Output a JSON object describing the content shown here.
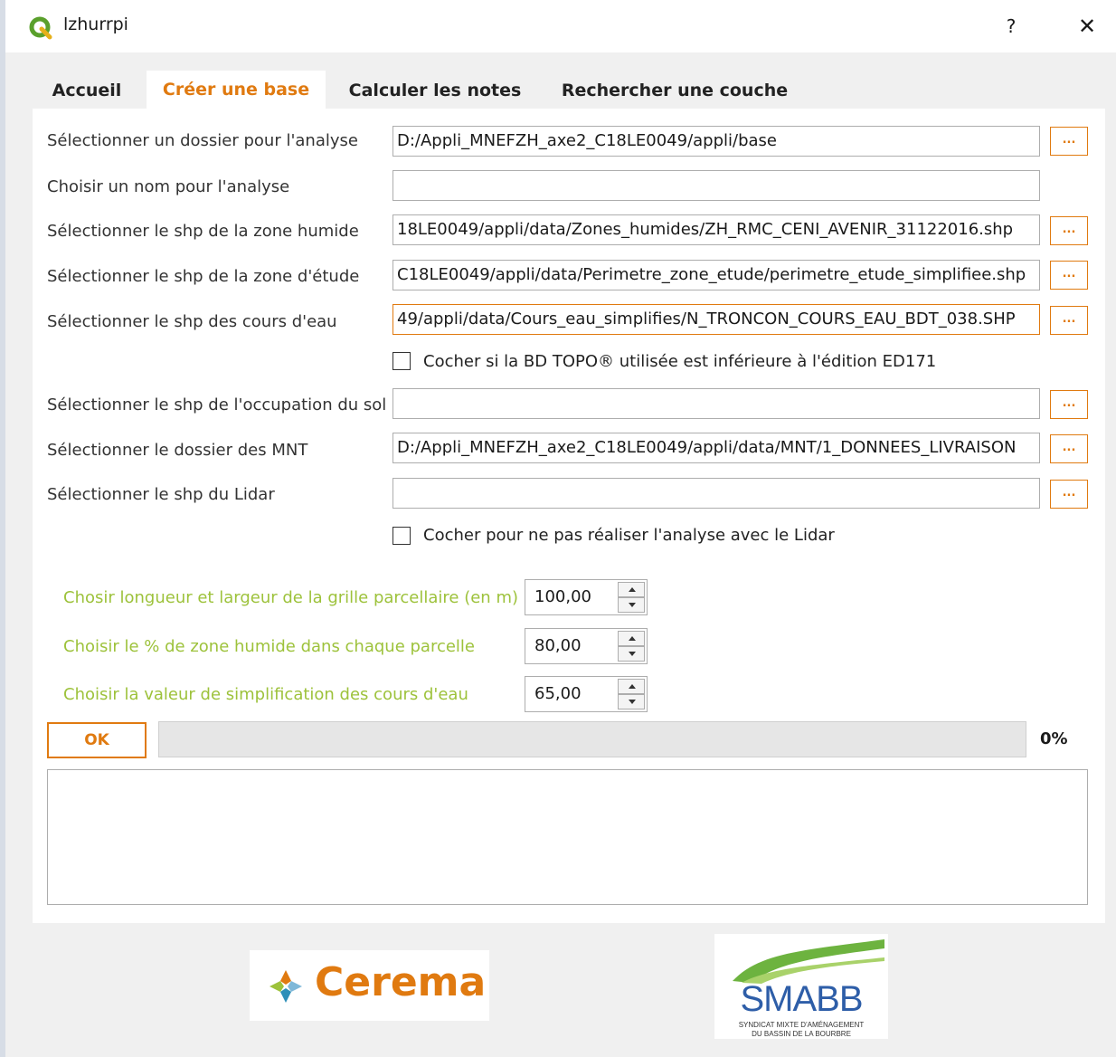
{
  "window": {
    "title": "lzhurrpi",
    "help_label": "?",
    "close_label": "✕"
  },
  "tabs": [
    {
      "label": "Accueil"
    },
    {
      "label": "Créer une base"
    },
    {
      "label": "Calculer les notes"
    },
    {
      "label": "Rechercher une couche"
    }
  ],
  "active_tab": "Créer une base",
  "form": {
    "folder": {
      "label": "Sélectionner un dossier pour l'analyse",
      "value": "D:/Appli_MNEFZH_axe2_C18LE0049/appli/base"
    },
    "name": {
      "label": "Choisir un nom pour l'analyse",
      "value": ""
    },
    "zone_humide": {
      "label": "Sélectionner le shp de la zone humide",
      "value": "18LE0049/appli/data/Zones_humides/ZH_RMC_CENI_AVENIR_31122016.shp"
    },
    "zone_etude": {
      "label": "Sélectionner le shp de la zone d'étude",
      "value": "C18LE0049/appli/data/Perimetre_zone_etude/perimetre_etude_simplifiee.shp"
    },
    "cours_eau": {
      "label": "Sélectionner le shp des cours d'eau",
      "value": "49/appli/data/Cours_eau_simplifies/N_TRONCON_COURS_EAU_BDT_038.SHP"
    },
    "bdtopo_check": {
      "label": "Cocher si la BD TOPO® utilisée est inférieure à l'édition ED171",
      "checked": false
    },
    "occupation_sol": {
      "label": "Sélectionner le shp de l'occupation du sol",
      "value": ""
    },
    "mnt": {
      "label": "Sélectionner le dossier des MNT",
      "value": "D:/Appli_MNEFZH_axe2_C18LE0049/appli/data/MNT/1_DONNEES_LIVRAISON"
    },
    "lidar": {
      "label": "Sélectionner le shp du Lidar",
      "value": ""
    },
    "lidar_check": {
      "label": "Cocher pour ne pas réaliser l'analyse avec le Lidar",
      "checked": false
    },
    "browse_label": "..."
  },
  "params": {
    "grille": {
      "label": "Chosir longueur et largeur de la grille parcellaire (en m)",
      "value": "100,00"
    },
    "pct_zh": {
      "label": "Choisir le % de zone humide dans chaque parcelle",
      "value": "80,00"
    },
    "simplification": {
      "label": "Choisir la valeur de simplification des cours d'eau",
      "value": "65,00"
    }
  },
  "actions": {
    "ok_label": "OK",
    "progress": 0,
    "progress_text": "0%"
  },
  "log": {
    "text": ""
  },
  "logos": {
    "cerema": {
      "text": "Cerema"
    },
    "smabb": {
      "text": "SMABB",
      "sub1": "SYNDICAT MIXTE D'AMÉNAGEMENT",
      "sub2": "DU BASSIN DE LA BOURBRE"
    }
  },
  "colors": {
    "accent": "#e07a10",
    "param_label": "#9dc23b",
    "brand_blue": "#2e5ea8",
    "app_green": "#5aa02c"
  }
}
